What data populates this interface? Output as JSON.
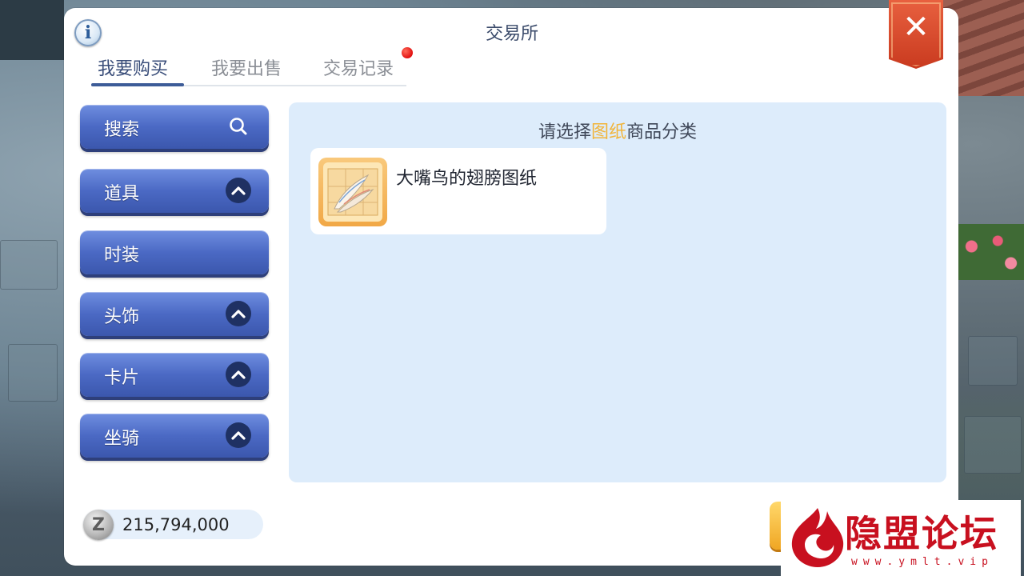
{
  "window": {
    "title": "交易所",
    "info_icon": "info-icon",
    "close_icon": "close-icon"
  },
  "tabs": [
    {
      "label": "我要购买",
      "active": true
    },
    {
      "label": "我要出售",
      "active": false
    },
    {
      "label": "交易记录",
      "active": false,
      "has_notification": true
    }
  ],
  "sidebar": {
    "search": {
      "label": "搜索",
      "icon": "search-icon"
    },
    "categories": [
      {
        "label": "道具",
        "icon": "chevron-up-icon"
      },
      {
        "label": "时装",
        "icon": null
      },
      {
        "label": "头饰",
        "icon": "chevron-up-icon"
      },
      {
        "label": "卡片",
        "icon": "chevron-up-icon"
      },
      {
        "label": "坐骑",
        "icon": "chevron-up-icon"
      }
    ]
  },
  "panel": {
    "prompt_before": "请选择",
    "prompt_highlight": "图纸",
    "prompt_after": "商品分类",
    "items": [
      {
        "name": "大嘴鸟的翅膀图纸",
        "icon": "feather-blueprint-icon"
      }
    ]
  },
  "currency": {
    "icon": "zeny-coin-icon",
    "amount": "215,794,000"
  },
  "watermark": {
    "text": "隐盟论坛",
    "url": "www.ymlt.vip"
  },
  "colors": {
    "accent_blue": "#4b69c4",
    "highlight": "#f1b43a",
    "close_red": "#d9472a",
    "panel_bg": "#ddecfb"
  }
}
